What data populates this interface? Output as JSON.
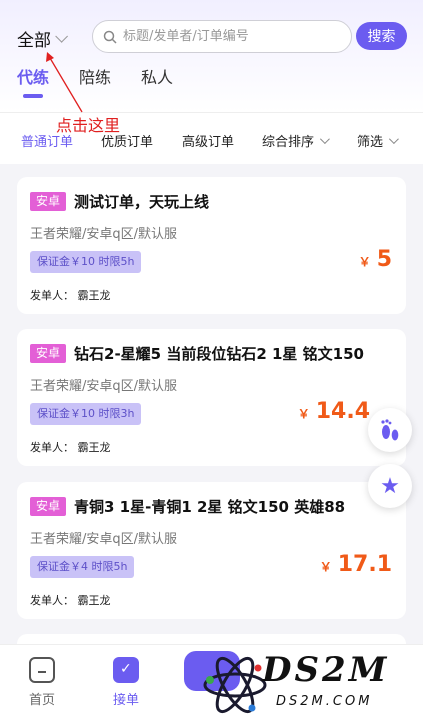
{
  "header": {
    "region_label": "全部",
    "search_placeholder": "标题/发单者/订单编号",
    "search_button": "搜索",
    "tabs": [
      {
        "label": "代练",
        "active": true
      },
      {
        "label": "陪练",
        "active": false
      },
      {
        "label": "私人",
        "active": false
      }
    ]
  },
  "annotation": {
    "text": "点击这里",
    "color": "#e02020"
  },
  "filters": [
    {
      "label": "普通订单",
      "active": true
    },
    {
      "label": "优质订单",
      "active": false
    },
    {
      "label": "高级订单",
      "active": false
    },
    {
      "label": "综合排序",
      "active": false
    },
    {
      "label": "筛选",
      "active": false
    }
  ],
  "orders": [
    {
      "platform": "安卓",
      "title": "测试订单，天玩上线",
      "game": "王者荣耀/安卓q区/默认服",
      "deposit": "保证金￥10 时限5h",
      "publisher": "发单人：  霸王龙",
      "currency": "￥",
      "price": "5"
    },
    {
      "platform": "安卓",
      "title": "钻石2-星耀5 当前段位钻石2 1星 铭文150",
      "game": "王者荣耀/安卓q区/默认服",
      "deposit": "保证金￥10 时限3h",
      "publisher": "发单人：  霸王龙",
      "currency": "￥",
      "price": "14.4"
    },
    {
      "platform": "安卓",
      "title": "青铜3 1星-青铜1 2星 铭文150 英雄88",
      "game": "王者荣耀/安卓q区/默认服",
      "deposit": "保证金￥4 时限5h",
      "publisher": "发单人：  霸王龙",
      "currency": "￥",
      "price": "17.1"
    }
  ],
  "floating": {
    "footprint_icon": "footprint-icon",
    "star_icon": "star-icon"
  },
  "bottom_nav": [
    {
      "label": "首页",
      "icon": "home-icon",
      "active": false
    },
    {
      "label": "接单",
      "icon": "order-icon",
      "active": true
    }
  ],
  "watermark": {
    "big": "DS2M",
    "small": "DS2M.COM"
  },
  "colors": {
    "accent": "#6b5cf0",
    "price": "#f05a18",
    "badge": "#e35fd6",
    "annotation": "#e02020"
  }
}
